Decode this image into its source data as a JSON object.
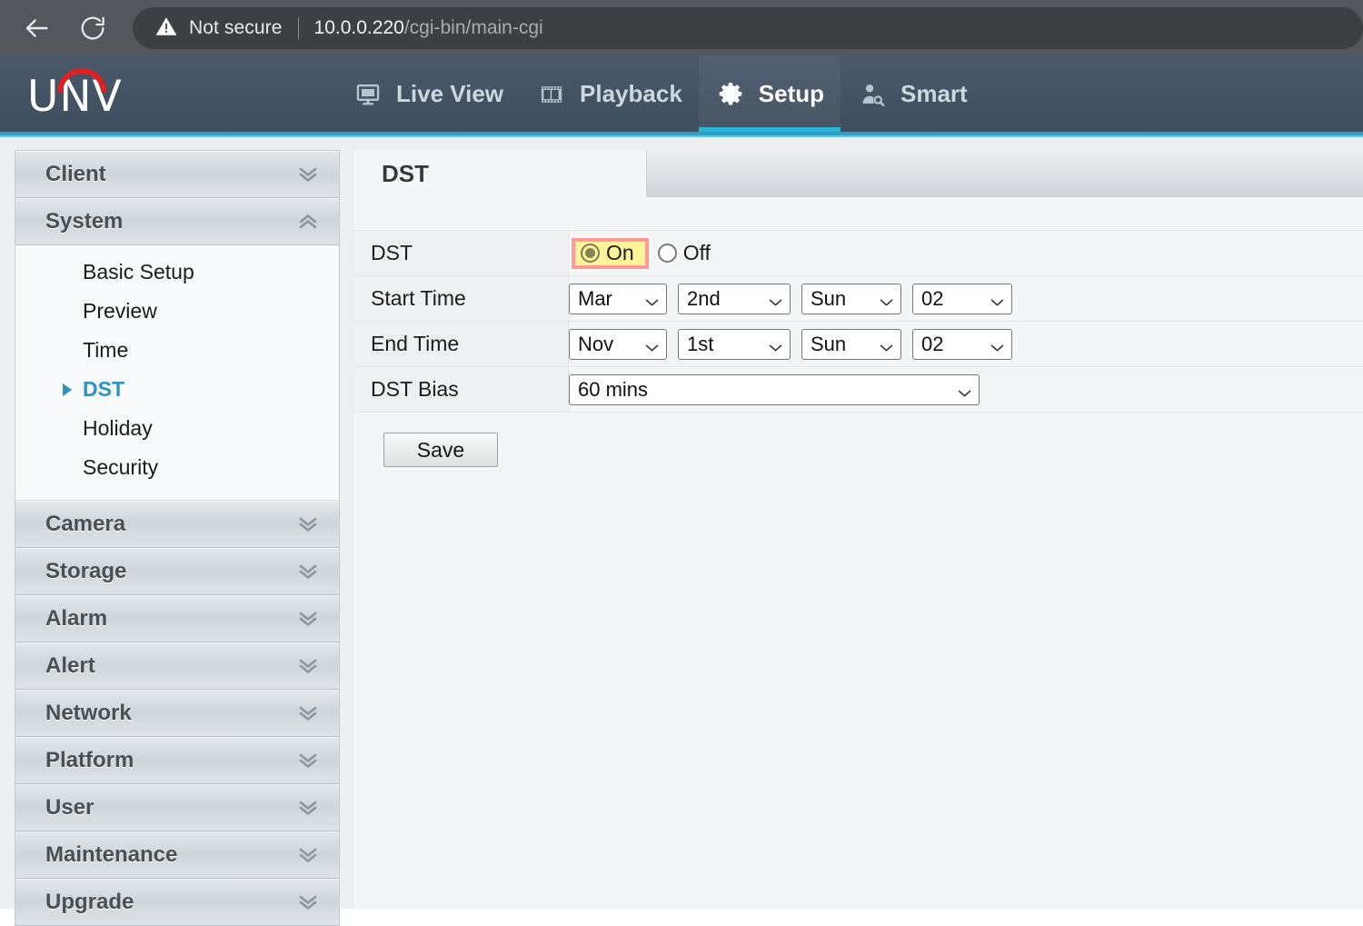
{
  "browser": {
    "back_icon": "back-arrow-icon",
    "reload_icon": "reload-icon",
    "security_warning": "Not secure",
    "url_host": "10.0.0.220",
    "url_path": "/cgi-bin/main-cgi"
  },
  "header": {
    "logo_text": "UNV",
    "logo_accent_color": "#e02020",
    "accent_color": "#2cb3d9",
    "nav": [
      {
        "label": "Live View",
        "icon": "monitor-icon",
        "active": false
      },
      {
        "label": "Playback",
        "icon": "film-strip-icon",
        "active": false
      },
      {
        "label": "Setup",
        "icon": "gear-icon",
        "active": true
      },
      {
        "label": "Smart",
        "icon": "person-search-icon",
        "active": false
      }
    ]
  },
  "sidebar": {
    "groups": [
      {
        "label": "Client",
        "expanded": false,
        "items": []
      },
      {
        "label": "System",
        "expanded": true,
        "items": [
          {
            "label": "Basic Setup",
            "active": false
          },
          {
            "label": "Preview",
            "active": false
          },
          {
            "label": "Time",
            "active": false
          },
          {
            "label": "DST",
            "active": true
          },
          {
            "label": "Holiday",
            "active": false
          },
          {
            "label": "Security",
            "active": false
          }
        ]
      },
      {
        "label": "Camera",
        "expanded": false,
        "items": []
      },
      {
        "label": "Storage",
        "expanded": false,
        "items": []
      },
      {
        "label": "Alarm",
        "expanded": false,
        "items": []
      },
      {
        "label": "Alert",
        "expanded": false,
        "items": []
      },
      {
        "label": "Network",
        "expanded": false,
        "items": []
      },
      {
        "label": "Platform",
        "expanded": false,
        "items": []
      },
      {
        "label": "User",
        "expanded": false,
        "items": []
      },
      {
        "label": "Maintenance",
        "expanded": false,
        "items": []
      },
      {
        "label": "Upgrade",
        "expanded": false,
        "items": []
      }
    ]
  },
  "content": {
    "tab_label": "DST",
    "rows": {
      "dst": {
        "label": "DST",
        "on_label": "On",
        "off_label": "Off",
        "selected": "On",
        "highlight_fill": "#fdf39b",
        "highlight_border": "#ff9a96"
      },
      "start_time": {
        "label": "Start Time",
        "month": "Mar",
        "ordinal": "2nd",
        "weekday": "Sun",
        "hour": "02"
      },
      "end_time": {
        "label": "End Time",
        "month": "Nov",
        "ordinal": "1st",
        "weekday": "Sun",
        "hour": "02"
      },
      "dst_bias": {
        "label": "DST Bias",
        "value": "60 mins"
      }
    },
    "save_label": "Save"
  }
}
